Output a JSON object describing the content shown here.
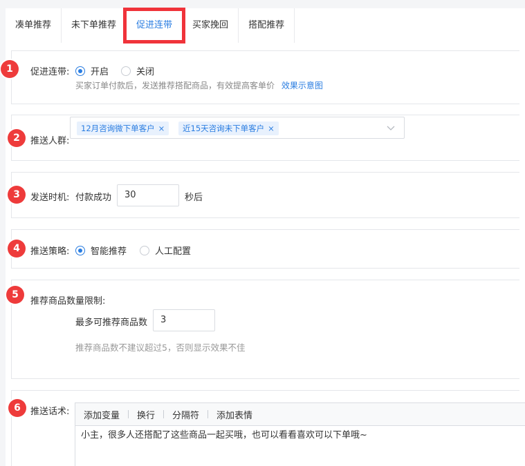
{
  "tabs": [
    "凑单推荐",
    "未下单推荐",
    "促进连带",
    "买家挽回",
    "搭配推荐"
  ],
  "active_tab": 2,
  "sections": {
    "s1": {
      "badge": "1",
      "label": "促进连带:",
      "option_on": "开启",
      "option_off": "关闭",
      "selected": "开启",
      "hint": "买家订单付款后，发送推荐搭配商品，有效提高客单价",
      "hint_link": "效果示意图"
    },
    "s2": {
      "badge": "2",
      "label": "推送人群:",
      "tags": [
        "12月咨询微下单客户",
        "近15天咨询未下单客户"
      ],
      "remove_icon": "×"
    },
    "s3": {
      "badge": "3",
      "label": "发送时机:",
      "prefix": "付款成功",
      "value": "30",
      "suffix": "秒后"
    },
    "s4": {
      "badge": "4",
      "label": "推送策略:",
      "option_smart": "智能推荐",
      "option_manual": "人工配置",
      "selected": "智能推荐"
    },
    "s5": {
      "badge": "5",
      "label": "推荐商品数量限制:",
      "field_label": "最多可推荐商品数",
      "value": "3",
      "hint": "推荐商品数不建议超过5，否则显示效果不佳"
    },
    "s6": {
      "badge": "6",
      "label": "推送话术:",
      "toolbar": [
        "添加变量",
        "换行",
        "分隔符",
        "添加表情"
      ],
      "content": "小主，很多人还搭配了这些商品一起买哦，也可以看看喜欢可以下单哦~"
    }
  },
  "colors": {
    "accent": "#2a7de1",
    "badge": "#ee3b3b",
    "highlight": "#f0333a"
  }
}
